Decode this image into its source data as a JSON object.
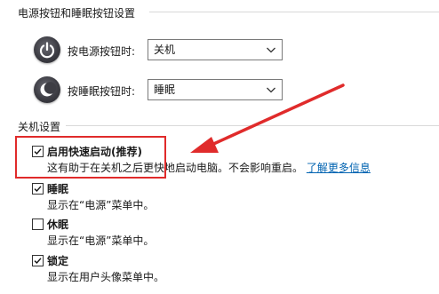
{
  "power_buttons_section": {
    "title": "电源按钮和睡眠按钮设置",
    "power_button": {
      "label": "按电源按钮时:",
      "selected": "关机",
      "icon": "power-icon"
    },
    "sleep_button": {
      "label": "按睡眠按钮时:",
      "selected": "睡眠",
      "icon": "sleep-moon-icon"
    }
  },
  "shutdown_section": {
    "title": "关机设置",
    "options": [
      {
        "name": "fast-startup",
        "label": "启用快速启动(推荐)",
        "checked": true,
        "description": "这有助于在关机之后更快地启动电脑。不会影响重启。",
        "link": "了解更多信息"
      },
      {
        "name": "sleep",
        "label": "睡眠",
        "checked": true,
        "description": "显示在“电源”菜单中。"
      },
      {
        "name": "hibernate",
        "label": "休眠",
        "checked": false,
        "description": "显示在“电源”菜单中。"
      },
      {
        "name": "lock",
        "label": "锁定",
        "checked": true,
        "description": "显示在用户头像菜单中。"
      }
    ]
  },
  "colors": {
    "highlight": "#e02b2b",
    "link": "#0063b1"
  }
}
